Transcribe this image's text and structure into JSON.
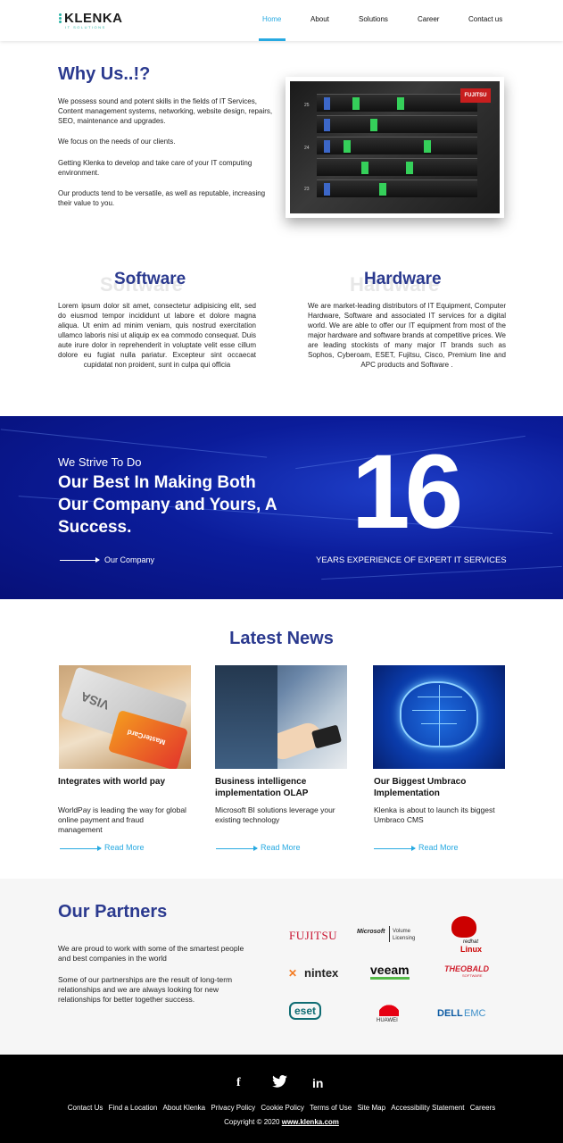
{
  "brand": {
    "name": "KLENKA",
    "tagline": "IT SOLUTIONS"
  },
  "nav": [
    {
      "label": "Home",
      "active": true
    },
    {
      "label": "About"
    },
    {
      "label": "Solutions"
    },
    {
      "label": "Career"
    },
    {
      "label": "Contact us"
    }
  ],
  "why": {
    "title": "Why Us..!?",
    "paragraphs": [
      "We possess sound and potent skills in the fields of IT Services, Content management systems, networking, website design, repairs, SEO, maintenance and upgrades.",
      "We focus on the needs of our clients.",
      "Getting Klenka to develop and take care of your IT computing environment.",
      "Our products tend to be versatile, as well as reputable, increasing their value to you."
    ],
    "image_badge": "FUJITSU",
    "image_numbers": [
      "25",
      "24",
      "23"
    ]
  },
  "software": {
    "title": "Software",
    "text": "Lorem ipsum dolor sit amet, consectetur adipisicing elit, sed do eiusmod tempor incididunt ut labore et dolore magna aliqua. Ut enim ad minim veniam, quis nostrud exercitation ullamco laboris nisi ut aliquip ex ea commodo consequat. Duis aute irure dolor in reprehenderit in voluptate velit esse cillum dolore eu fugiat nulla pariatur. Excepteur sint occaecat cupidatat non proident, sunt in culpa qui officia"
  },
  "hardware": {
    "title": "Hardware",
    "text": "We are market-leading distributors of IT Equipment, Computer Hardware, Software and associated IT services for a digital world. We are able to offer our IT equipment from most of the major hardware and software brands at competitive prices. We are leading stockists of many major IT brands such as Sophos, Cyberoam, ESET, Fujitsu, Cisco, Premium line and APC products and Software ."
  },
  "banner": {
    "subtitle": "We Strive To Do",
    "heading": "Our Best In Making Both Our Company and Yours, A Success.",
    "link": "Our Company",
    "years": "16",
    "years_caption": "YEARS EXPERIENCE OF EXPERT IT SERVICES"
  },
  "news": {
    "title": "Latest News",
    "items": [
      {
        "heading": "Integrates with world pay",
        "text": "WorldPay is leading the way for global online payment and fraud management",
        "link": "Read More"
      },
      {
        "heading": "Business intelligence implementation OLAP",
        "text": "Microsoft BI solutions leverage your existing technology",
        "link": "Read More"
      },
      {
        "heading": "Our Biggest Umbraco Implementation",
        "text": "Klenka is about to launch its biggest Umbraco CMS",
        "link": "Read More"
      }
    ],
    "card_text": [
      "VISA",
      "MasterCard"
    ]
  },
  "partners": {
    "title": "Our Partners",
    "paragraphs": [
      "We are proud to work with some of the smartest people and best companies in the world",
      "Some of our partnerships are the result of long-term relationships and we are always looking for new relationships for better together success."
    ],
    "logos": [
      "FUJITSU",
      "Microsoft",
      "Volume Licensing",
      "redhat",
      "Linux",
      "nintex",
      "veeam",
      "THEOBALD",
      "SOFTWARE",
      "eset",
      "HUAWEI",
      "DELL",
      "EMC"
    ]
  },
  "footer": {
    "social": [
      "f",
      "twitter",
      "in"
    ],
    "links": [
      "Contact Us",
      "Find a Location",
      "About Klenka",
      "Privacy Policy",
      "Cookie Policy",
      "Terms of Use",
      "Site Map",
      "Accessibility Statement",
      "Careers"
    ],
    "copyright": "Copyright © 2020",
    "domain": "www.klenka.com"
  }
}
